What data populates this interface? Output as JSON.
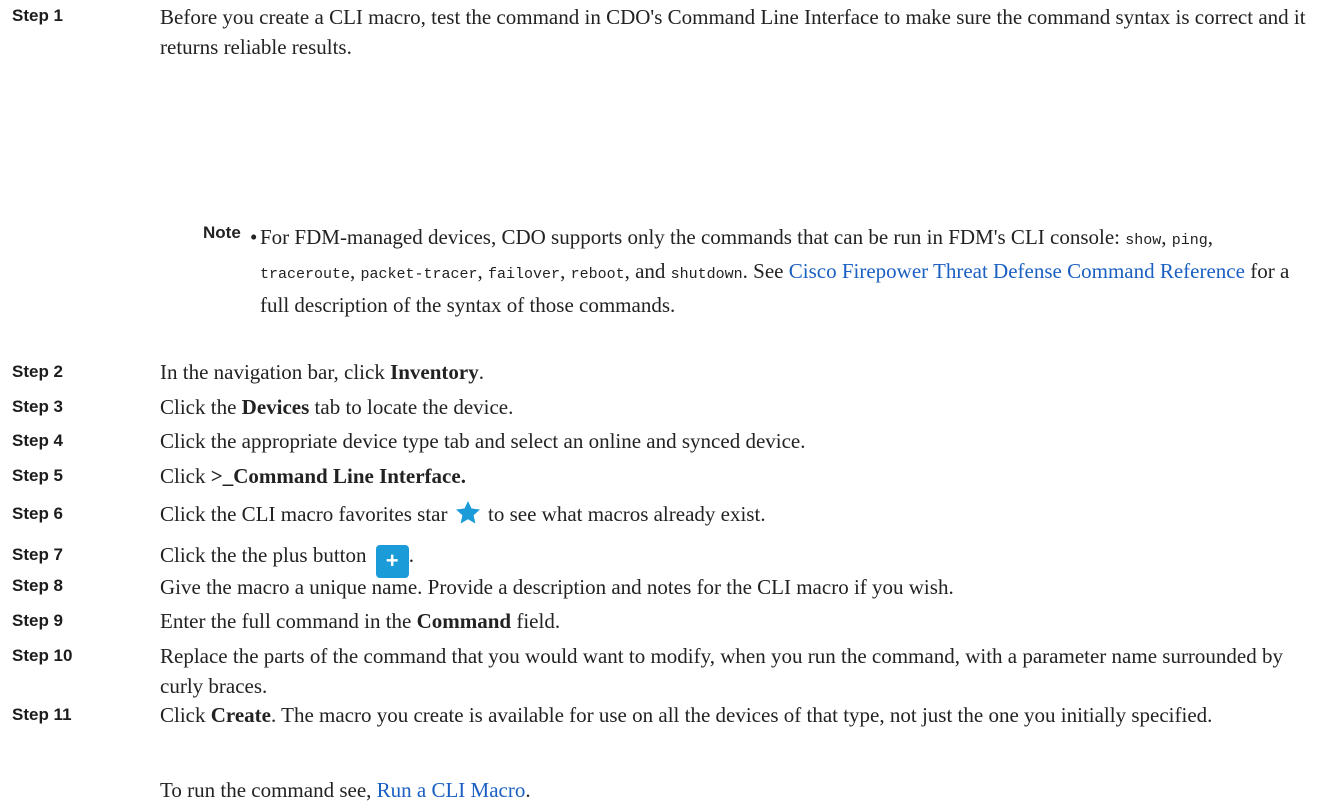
{
  "steps": [
    {
      "label": "Step 1",
      "text": "Before you create a CLI macro, test the command in CDO's Command Line Interface to make sure the command syntax is correct and it returns reliable results."
    },
    {
      "label": "Step 2",
      "before": "In the navigation bar, click ",
      "bold": "Inventory",
      "after": "."
    },
    {
      "label": "Step 3",
      "before": "Click the ",
      "bold": "Devices",
      "after": " tab to locate the device."
    },
    {
      "label": "Step 4",
      "text": "Click the appropriate device type tab and select an online and synced device."
    },
    {
      "label": "Step 5",
      "before": "Click ",
      "bold": ">_Command Line Interface."
    },
    {
      "label": "Step 6",
      "before": "Click the CLI macro favorites star",
      "after": " to see what macros already exist."
    },
    {
      "label": "Step 7",
      "before": "Click the the plus button",
      "after": "."
    },
    {
      "label": "Step 8",
      "text": "Give the macro a unique name. Provide a description and notes for the CLI macro if you wish."
    },
    {
      "label": "Step 9",
      "before": "Enter the full command in the ",
      "bold": "Command",
      "after": " field."
    },
    {
      "label": "Step 10",
      "text": "Replace the parts of the command that you would want to modify, when you run the command, with a parameter name surrounded by curly braces."
    },
    {
      "label": "Step 11",
      "before": "Click ",
      "bold": "Create",
      "after": ". The macro you create is available for use on all the devices of that type, not just the one you initially specified."
    }
  ],
  "note": {
    "label": "Note",
    "bullet": "•",
    "intro": "For FDM-managed devices, CDO supports only the commands that can be run in FDM's CLI console: ",
    "commands": [
      "show",
      "ping",
      "traceroute",
      "packet-tracer",
      "failover",
      "reboot",
      "shutdown"
    ],
    "sep": ", ",
    "and": "and",
    "see": ". See ",
    "link": "Cisco Firepower Threat Defense Command Reference",
    "outro": " for a full description of the syntax of those commands."
  },
  "footer": {
    "text": "To run the command see, ",
    "link": "Run a CLI Macro",
    "end": "."
  },
  "icons": {
    "star": "star-icon",
    "plus": "plus-icon",
    "plus_glyph": "+"
  },
  "colors": {
    "link": "#1a5fc2",
    "star": "#1b9bd8",
    "plus_bg": "#1b9bd8"
  }
}
